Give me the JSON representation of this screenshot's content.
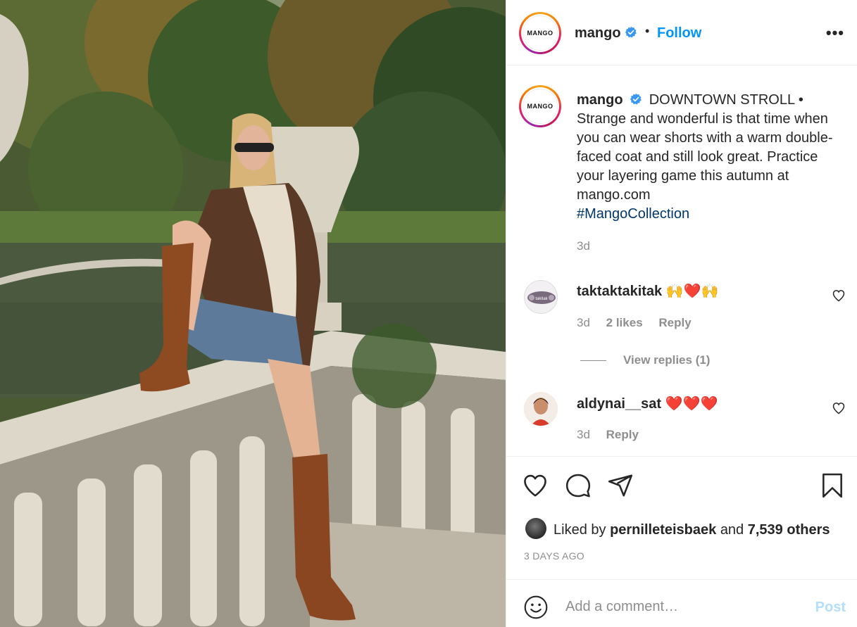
{
  "post": {
    "image_alt": "Model in sunglasses, shearling coat, denim shorts and tall brown boots sitting on a stone balustrade by a park pond"
  },
  "header": {
    "avatar_text": "MANGO",
    "username": "mango",
    "separator": "•",
    "follow_label": "Follow",
    "more_label": "•••"
  },
  "caption": {
    "avatar_text": "MANGO",
    "username": "mango",
    "text": "DOWNTOWN STROLL • Strange and wonderful is that time when you can wear shorts with a warm double-faced coat and still look great. Practice your layering game this autumn at mango.com",
    "hashtag": "#MangoCollection",
    "time": "3d"
  },
  "comments": [
    {
      "username": "taktaktakitak",
      "text": "🙌❤️🙌",
      "time": "3d",
      "likes": "2 likes",
      "reply_label": "Reply",
      "avatar_text": "takitak",
      "view_replies": "View replies (1)"
    },
    {
      "username": "aldynai__sat",
      "text": "❤️❤️❤️",
      "time": "3d",
      "reply_label": "Reply"
    }
  ],
  "actions": {
    "liked_prefix": "Liked by",
    "liked_user": "pernilleteisbaek",
    "liked_and": "and",
    "liked_others": "7,539 others",
    "ago": "3 DAYS AGO"
  },
  "add_comment": {
    "placeholder": "Add a comment…",
    "post_label": "Post"
  },
  "colors": {
    "accent": "#0095f6",
    "hashtag": "#00376b",
    "muted": "#8e8e8e",
    "post_disabled": "#b2dffc"
  },
  "icons": [
    "verified-badge-icon",
    "more-options-icon",
    "heart-icon",
    "comment-icon",
    "share-icon",
    "bookmark-icon",
    "emoji-icon"
  ]
}
